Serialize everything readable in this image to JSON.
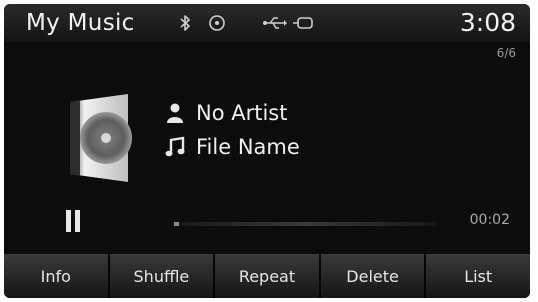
{
  "status_bar": {
    "title": "My Music",
    "clock": "3:08",
    "icons": [
      "bluetooth-icon",
      "disc-icon",
      "usb-icon",
      "aux-icon"
    ]
  },
  "track": {
    "position": "6/6",
    "artist": "No Artist",
    "file_name": "File Name",
    "elapsed": "00:02",
    "progress_fraction": 0.02,
    "playback_state": "playing"
  },
  "softkeys": [
    "Info",
    "Shuffle",
    "Repeat",
    "Delete",
    "List"
  ],
  "colors": {
    "background": "#0c0c0c",
    "text": "#f0f0f0",
    "softkey_top": "#3a3a3a",
    "softkey_bottom": "#151515"
  }
}
